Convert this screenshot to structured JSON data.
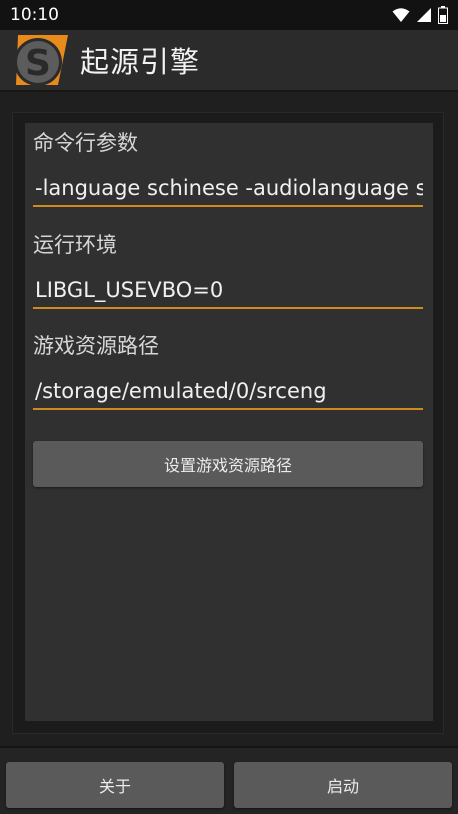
{
  "status_bar": {
    "time": "10:10",
    "icons": [
      "wifi-icon",
      "signal-icon",
      "battery-icon"
    ]
  },
  "action_bar": {
    "title": "起源引擎",
    "logo_icon": "source-engine-logo"
  },
  "fields": {
    "command_line_label": "命令行参数",
    "command_line_value": "-language schinese -audiolanguage sc",
    "env_label": "运行环境",
    "env_value": "LIBGL_USEVBO=0",
    "path_label": "游戏资源路径",
    "path_value": "/storage/emulated/0/srceng"
  },
  "buttons": {
    "set_path": "设置游戏资源路径",
    "about": "关于",
    "start": "启动"
  },
  "colors": {
    "accent": "#d18a1e",
    "background": "#1f1f1f",
    "panel": "#303030",
    "button": "#5a5a5a"
  }
}
